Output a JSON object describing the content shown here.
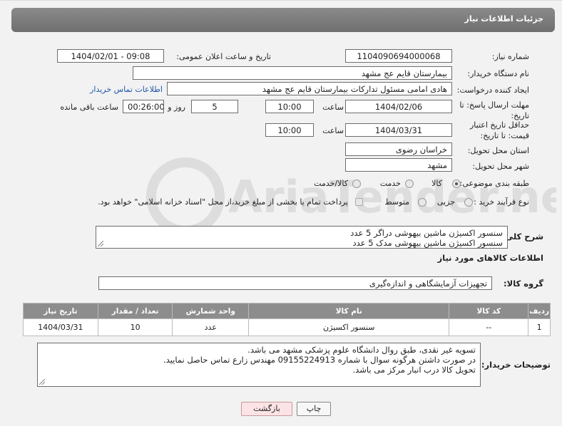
{
  "header": {
    "title": "جزئیات اطلاعات نیاز"
  },
  "form": {
    "need_number_label": "شماره نیاز:",
    "need_number": "1104090694000068",
    "announce_label": "تاریخ و ساعت اعلان عمومی:",
    "announce_value": "1404/02/01 - 09:08",
    "buyer_org_label": "نام دستگاه خریدار:",
    "buyer_org": "بیمارستان قایم  عج  مشهد",
    "requester_label": "ایجاد کننده درخواست:",
    "requester": "هادی امامی مسئول تدارکات بیمارستان قایم  عج  مشهد",
    "buyer_contact_link": "اطلاعات تماس خریدار",
    "deadline_label": "مهلت ارسال پاسخ: تا تاریخ:",
    "deadline_date": "1404/02/06",
    "time_label": "ساعت",
    "deadline_time": "10:00",
    "days_value": "5",
    "days_label": "روز و",
    "remaining_time": "00:26:00",
    "remaining_label": "ساعت باقی مانده",
    "price_validity_label": "حداقل تاریخ اعتبار قیمت: تا تاریخ:",
    "price_validity_date": "1404/03/31",
    "price_validity_time": "10:00",
    "province_label": "استان محل تحویل:",
    "province": "خراسان رضوی",
    "city_label": "شهر محل تحویل:",
    "city": "مشهد",
    "category_label": "طبقه بندی موضوعی:",
    "category_options": [
      "کالا",
      "خدمت",
      "کالا/خدمت"
    ],
    "purchase_type_label": "نوع فرآیند خرید :",
    "purchase_options": [
      "جزیی",
      "متوسط"
    ],
    "payment_note": "پرداخت تمام یا بخشی از مبلغ خرید،از محل \"اسناد خزانه اسلامی\" خواهد بود."
  },
  "summary": {
    "label": "شرح کلی نیاز:",
    "lines": [
      "سنسور اکسیژن ماشین بیهوشی دراگر 5 عدد",
      "سنسور اکسیژن ماشین بیهوشی مدک 5 عدد"
    ]
  },
  "goods_info": {
    "title": "اطلاعات کالاهای مورد نیاز",
    "group_label": "گروه کالا:",
    "group_value": "تجهیزات آزمایشگاهی و اندازه‌گیری"
  },
  "table": {
    "headers": [
      "ردیف",
      "کد کالا",
      "نام کالا",
      "واحد شمارش",
      "تعداد / مقدار",
      "تاریخ نیاز"
    ],
    "rows": [
      [
        "1",
        "--",
        "سنسور اکسیژن",
        "عدد",
        "10",
        "1404/03/31"
      ]
    ]
  },
  "buyer_notes": {
    "label": "توضیحات خریدار:",
    "lines": [
      "تسویه غیر نقدی، طبق روال دانشگاه علوم پزشکی مشهد می باشد.",
      "در صورت داشتن هرگونه سوال با  شماره 09155224913  مهندس  زارع تماس حاصل نمایید.",
      "تحویل کالا درب انبار مرکز می باشد."
    ]
  },
  "buttons": {
    "print": "چاپ",
    "back": "بازگشت"
  },
  "watermark": "AriaTender.neT"
}
